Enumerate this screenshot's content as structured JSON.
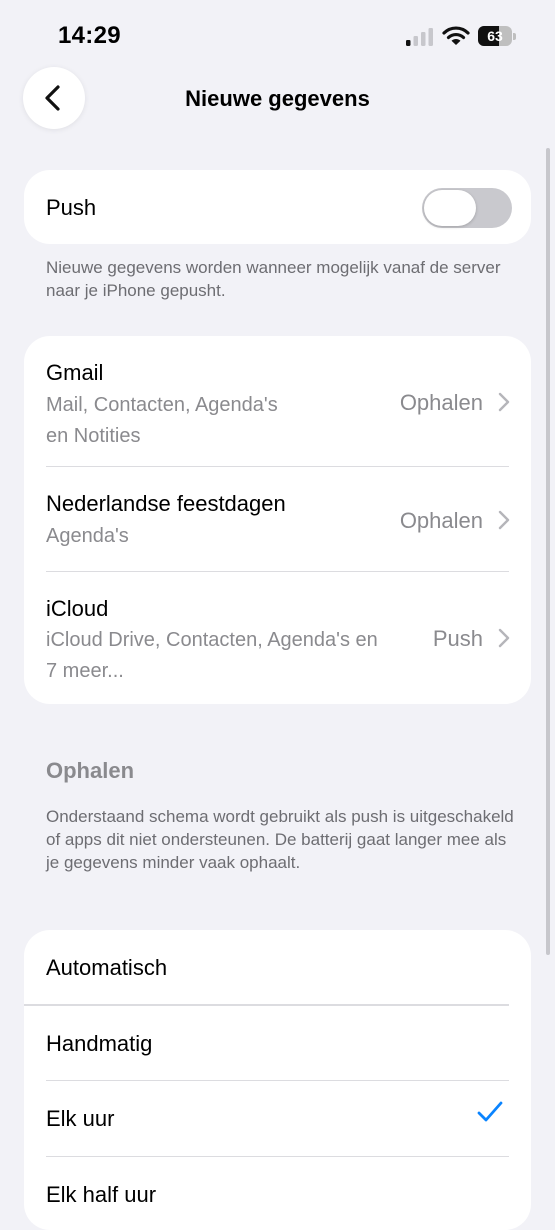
{
  "status_bar": {
    "time": "14:29",
    "battery_percent": 63,
    "battery_label": "63"
  },
  "nav": {
    "title": "Nieuwe gegevens"
  },
  "push": {
    "label": "Push",
    "enabled": false,
    "footnote": "Nieuwe gegevens worden wanneer mogelijk vanaf de server naar je iPhone gepusht."
  },
  "accounts": [
    {
      "name": "Gmail",
      "services_line1": "Mail, Contacten, Agenda's",
      "services_line2": "en Notities",
      "mode": "Ophalen"
    },
    {
      "name": "Nederlandse feestdagen",
      "services_line1": "Agenda's",
      "mode": "Ophalen"
    },
    {
      "name": "iCloud",
      "services_line1": "iCloud Drive, Contacten, Agenda's en",
      "services_line2": "7 meer...",
      "mode": "Push"
    }
  ],
  "fetch": {
    "header": "Ophalen",
    "footnote": "Onderstaand schema wordt gebruikt als push is uitgeschakeld of apps dit niet ondersteunen. De batterij gaat langer mee als je gegevens minder vaak ophaalt.",
    "options": [
      {
        "label": "Automatisch",
        "selected": false
      },
      {
        "label": "Handmatig",
        "selected": false
      },
      {
        "label": "Elk uur",
        "selected": true
      },
      {
        "label": "Elk half uur",
        "selected": false
      }
    ]
  },
  "colors": {
    "accent": "#0a84ff",
    "background": "#f2f2f7",
    "secondary_text": "#8a8a8e"
  },
  "icons": {
    "back": "chevron-left-icon",
    "disclosure": "chevron-right-icon",
    "checkmark": "checkmark-icon"
  }
}
